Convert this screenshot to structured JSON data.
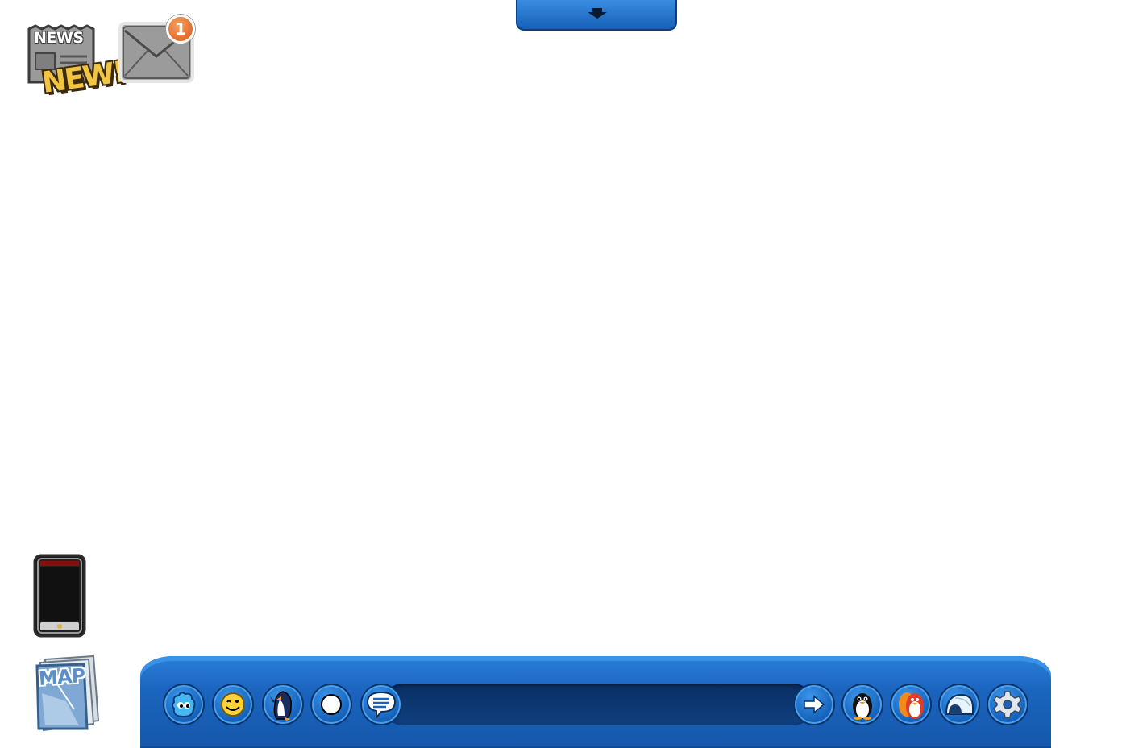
{
  "hud": {
    "newspaper": {
      "header": "NEWS",
      "badge": "NEW!"
    },
    "mail": {
      "unread_count": "1"
    },
    "map": {
      "label": "MAP"
    },
    "chat": {
      "placeholder": ""
    }
  },
  "toolbar": {
    "buttons": [
      {
        "name": "puffle-button",
        "icon": "puffle-icon"
      },
      {
        "name": "emote-button",
        "icon": "emote-smiley-icon"
      },
      {
        "name": "actions-button",
        "icon": "penguin-wave-icon"
      },
      {
        "name": "snowball-button",
        "icon": "snowball-icon"
      },
      {
        "name": "safe-chat-button",
        "icon": "chat-bubble-icon"
      },
      {
        "name": "send-button",
        "icon": "arrow-right-icon"
      },
      {
        "name": "player-card-button",
        "icon": "penguin-icon"
      },
      {
        "name": "buddies-button",
        "icon": "buddies-icon"
      },
      {
        "name": "igloo-button",
        "icon": "igloo-icon"
      },
      {
        "name": "settings-button",
        "icon": "gear-icon"
      }
    ]
  },
  "colors": {
    "toolbar_blue": "#1a63bd",
    "chat_bar_navy": "#0a2f63",
    "badge_orange": "#e46a26",
    "news_gold": "#f1c542"
  }
}
